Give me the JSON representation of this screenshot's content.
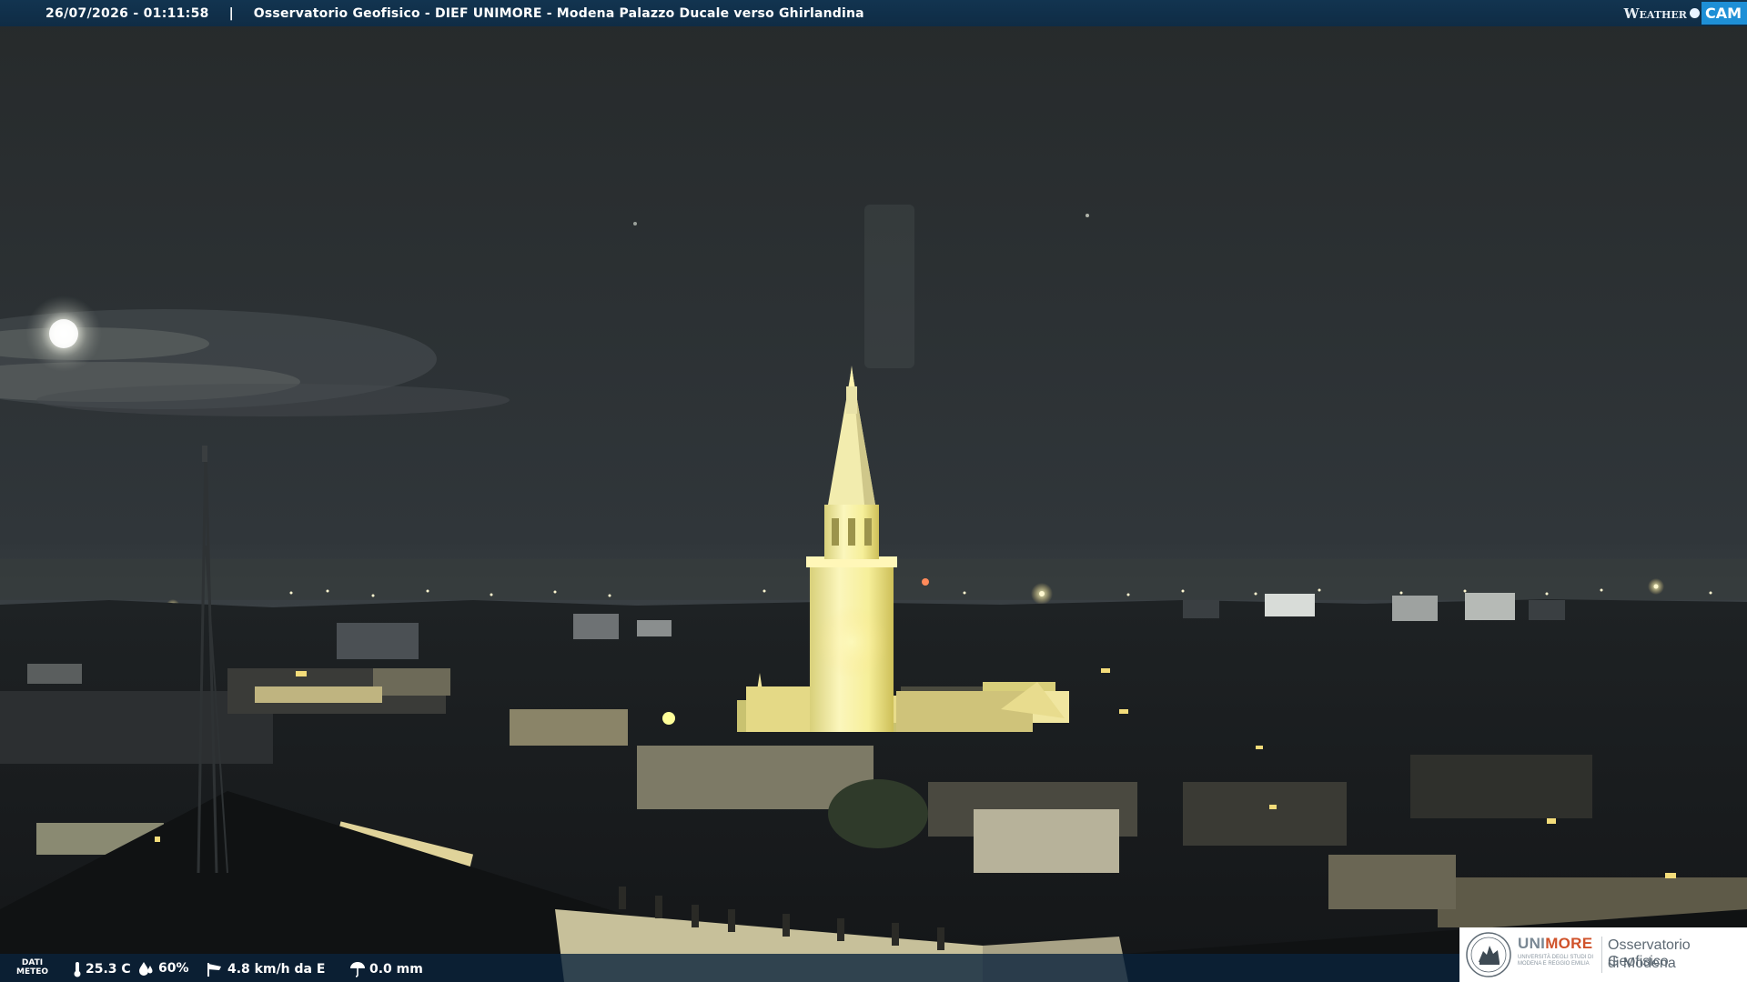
{
  "header": {
    "timestamp": "26/07/2026 - 01:11:58",
    "separator": "|",
    "camera_title": "Osservatorio Geofisico - DIEF UNIMORE - Modena Palazzo Ducale verso Ghirlandina"
  },
  "brand": {
    "logo_word": "Weather",
    "logo_badge": "CAM"
  },
  "weather": {
    "section_label_line1": "DATI",
    "section_label_line2": "METEO",
    "temperature": "25.3 C",
    "humidity": "60%",
    "wind": "4.8 km/h da E",
    "rain": "0.0 mm"
  },
  "sponsor": {
    "logo_part1": "UNI",
    "logo_part2": "MORE",
    "university_full": "UNIVERSITÀ DEGLI STUDI DI MODENA E REGGIO EMILIA",
    "observatory_line1": "Osservatorio Geofisico",
    "observatory_line2": "di Modena"
  },
  "icons": {
    "temperature": "thermometer-icon",
    "humidity": "raindrop-icon",
    "wind": "wind-sock-icon",
    "rain": "umbrella-icon"
  },
  "colors": {
    "bar_blue": "#0f2c45",
    "tower_light": "#f6f0a8",
    "sky": "#2a2e2e",
    "brand_orange": "#d0532b"
  }
}
